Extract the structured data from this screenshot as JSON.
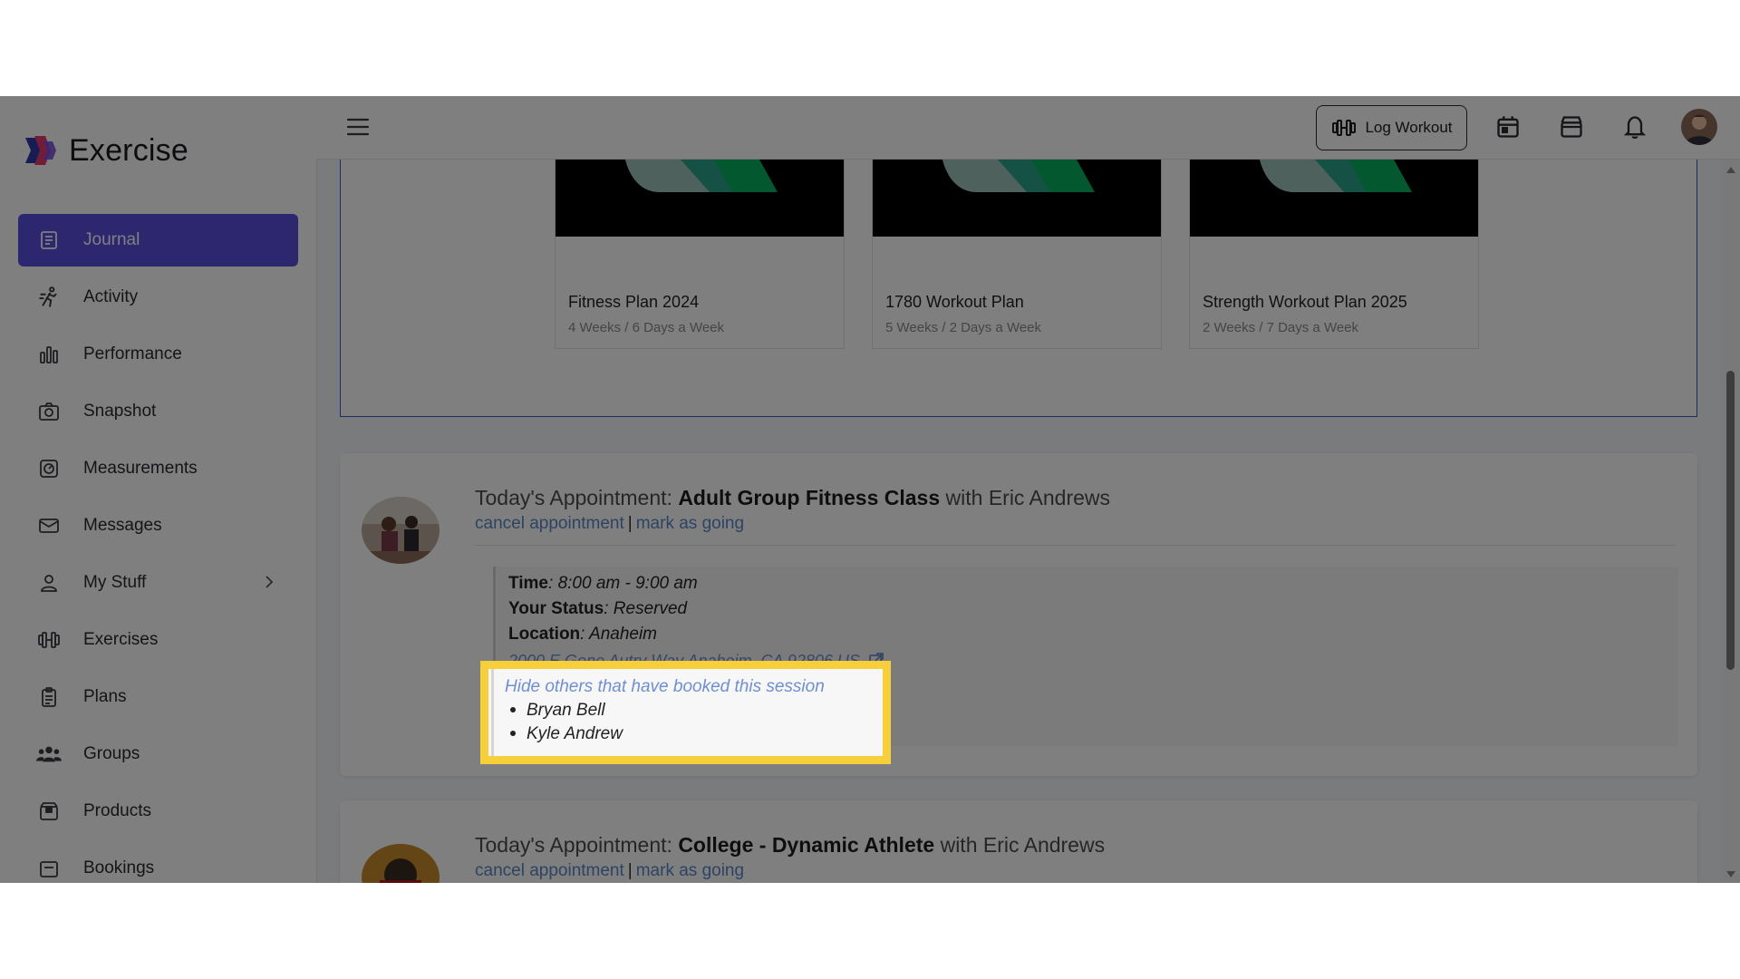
{
  "app": {
    "name": "Exercise"
  },
  "sidebar": {
    "items": [
      {
        "label": "Journal",
        "icon": "journal-icon",
        "active": true
      },
      {
        "label": "Activity",
        "icon": "activity-runner-icon"
      },
      {
        "label": "Performance",
        "icon": "bar-chart-icon"
      },
      {
        "label": "Snapshot",
        "icon": "camera-icon"
      },
      {
        "label": "Measurements",
        "icon": "measurement-icon"
      },
      {
        "label": "Messages",
        "icon": "envelope-icon"
      },
      {
        "label": "My Stuff",
        "icon": "user-icon",
        "expandable": true
      },
      {
        "label": "Exercises",
        "icon": "dumbbell-icon"
      },
      {
        "label": "Plans",
        "icon": "clipboard-icon"
      },
      {
        "label": "Groups",
        "icon": "group-icon"
      },
      {
        "label": "Products",
        "icon": "product-box-icon"
      },
      {
        "label": "Bookings",
        "icon": "booking-icon"
      }
    ]
  },
  "header": {
    "log_workout_label": "Log Workout",
    "icons": [
      "menu-icon",
      "dumbbell-icon",
      "calendar-icon",
      "store-icon",
      "bell-icon",
      "avatar"
    ]
  },
  "plans": [
    {
      "name": "Fitness Plan 2024",
      "subtitle": "4 Weeks / 6 Days a Week"
    },
    {
      "name": "1780 Workout Plan",
      "subtitle": "5 Weeks / 2 Days a Week"
    },
    {
      "name": "Strength Workout Plan 2025",
      "subtitle": "2 Weeks / 7 Days a Week"
    }
  ],
  "appointments": [
    {
      "prefix": "Today's Appointment: ",
      "class_name": "Adult Group Fitness Class",
      "with_text": " with Eric Andrews",
      "cancel_label": "cancel appointment",
      "separator": "|",
      "going_label": "mark as going",
      "time_label": "Time",
      "time_value": ": 8:00 am - 9:00 am",
      "status_label": "Your Status",
      "status_value": ": Reserved",
      "location_label": "Location",
      "location_value": ": Anaheim",
      "address": "2000 E Gene Autry Way Anaheim, CA 92806 US",
      "hide_label": "Hide others that have booked this session",
      "attendees": [
        "Bryan Bell",
        "Kyle Andrew"
      ]
    },
    {
      "prefix": "Today's Appointment: ",
      "class_name": "College - Dynamic Athlete",
      "with_text": " with Eric Andrews",
      "cancel_label": "cancel appointment",
      "separator": "|",
      "going_label": "mark as going"
    }
  ],
  "colors": {
    "accent": "#5b4fe0",
    "link": "#5a86c7",
    "highlight": "#f7cf3a",
    "plan_border": "#3d58c6"
  }
}
